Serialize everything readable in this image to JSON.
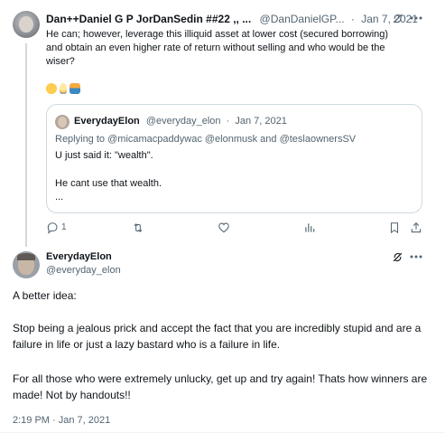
{
  "reply": {
    "author_name": "Dan++Daniel G P JorDanSedin ##22 ,, ...",
    "author_handle": "@DanDanielGP...",
    "separator": "·",
    "date": "Jan 7, 2021",
    "text": "He can; however, leverage this illiquid asset at lower cost (secured borrowing) and obtain an even higher rate of return without selling and who would be the wiser?",
    "emojis": [
      "thinking-face-emoji",
      "light-bulb-emoji",
      "sunrise-emoji"
    ]
  },
  "quoted": {
    "author_name": "EverydayElon",
    "author_handle": "@everyday_elon",
    "separator": "·",
    "date": "Jan 7, 2021",
    "replying_prefix": "Replying to",
    "replying_to": "@micamacpaddywac @elonmusk and @teslaownersSV",
    "line1": "U just said it: \"wealth\".",
    "line2": "He cant use that wealth.",
    "line3": "..."
  },
  "actions": {
    "reply_count": "1",
    "repost_count": "",
    "like_count": "",
    "views_count": ""
  },
  "main": {
    "author_name": "EverydayElon",
    "author_handle": "@everyday_elon",
    "paragraph1": "A better idea:",
    "paragraph2": "Stop being a jealous prick and accept the fact that you are incredibly stupid and are a failure in life or just a lazy bastard who is a failure in life.",
    "paragraph3": "For all those who were extremely unlucky, get up and try again! Thats how winners are made! Not by handouts!!",
    "timestamp": "2:19 PM · Jan 7, 2021"
  },
  "colors": {
    "text": "#0f1419",
    "muted": "#536471",
    "border": "#cfd9de"
  }
}
